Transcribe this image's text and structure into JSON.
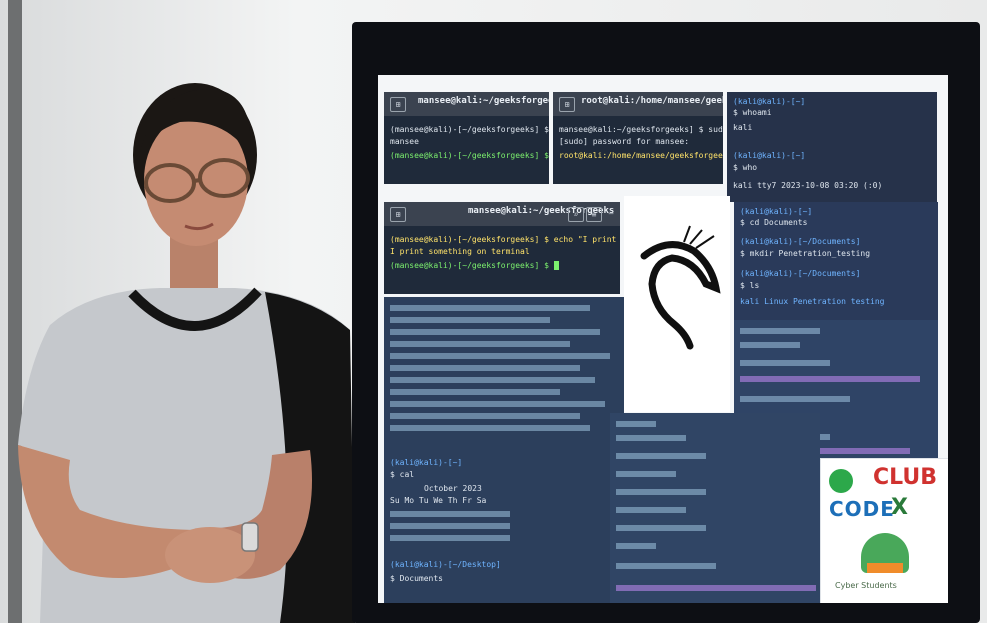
{
  "scene": {
    "description_colors": {
      "wall": "#eceef0",
      "tv_bezel": "#0d0f14",
      "terminal_bg": "#1f2a3a",
      "prompt_green": "#7cf06e",
      "prompt_blue": "#6fb4ff"
    }
  },
  "terminal_top_left": {
    "title": "mansee@kali:~/geeksforgeeks",
    "lines": [
      "(mansee@kali)-[~/geeksforgeeks] $ whoami",
      "mansee",
      "(mansee@kali)-[~/geeksforgeeks] $"
    ]
  },
  "terminal_top_mid": {
    "title": "root@kali:/home/mansee/geeksforgeeks",
    "lines": [
      "mansee@kali:~/geeksforgeeks] $ sudo su",
      "[sudo] password for mansee:",
      "root@kali:/home/mansee/geeksforgeeks#"
    ]
  },
  "terminal_top_right": {
    "lines": [
      "(kali@kali)-[~]",
      "$ whoami",
      "kali",
      "(kali@kali)-[~]",
      "$ who",
      "kali     tty7        2023-10-08 03:20 (:0)"
    ]
  },
  "terminal_mid_left": {
    "title": "mansee@kali:~/geeksforgeeks",
    "lines": [
      "(mansee@kali)-[~/geeksforgeeks] $ echo \"I print something on terminal\"",
      "I print something on terminal",
      "(mansee@kali)-[~/geeksforgeeks] $"
    ]
  },
  "terminal_right_mid": {
    "lines": [
      "(kali@kali)-[~]",
      "$ cd Documents",
      "(kali@kali)-[~/Documents]",
      "$ mkdir Penetration_testing",
      "(kali@kali)-[~/Documents]",
      "$ ls",
      "kali   Linux  Penetration  testing"
    ]
  },
  "terminal_bottom_left": {
    "lines": [
      "(kali@kali)-[~]",
      "$ cal",
      "October 2023",
      "Su Mo Tu We Th Fr Sa",
      "(kali@kali)-[~/Desktop]",
      "$ Documents"
    ]
  },
  "logo": {
    "club_text": "CLUB",
    "code_text": "CODE",
    "x_text": "X",
    "caption": "Cyber Students"
  }
}
